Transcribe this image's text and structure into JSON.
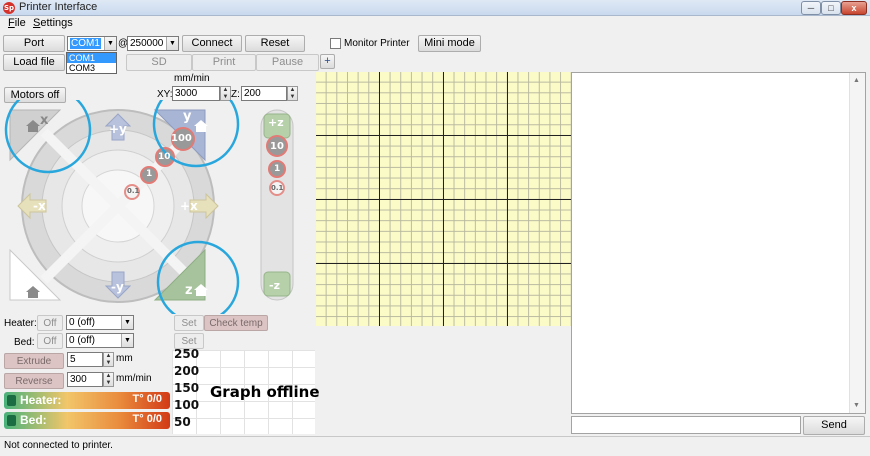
{
  "window": {
    "title": "Printer Interface",
    "icon_text": "Sp"
  },
  "menu": [
    "File",
    "Settings"
  ],
  "toolbar": {
    "port_label": "Port",
    "port_value": "COM1",
    "at_symbol": "@",
    "baud_value": "250000",
    "connect_label": "Connect",
    "reset_label": "Reset",
    "monitor_label": "Monitor Printer",
    "mini_mode_label": "Mini mode",
    "port_options": [
      "COM1",
      "COM3"
    ]
  },
  "toolbar2": {
    "load_file_label": "Load file",
    "sd_label": "SD",
    "print_label": "Print",
    "pause_label": "Pause",
    "plus_label": "+"
  },
  "jog": {
    "motors_off_label": "Motors off",
    "feed_unit": "mm/min",
    "xy_label": "XY:",
    "xy_value": "3000",
    "z_label": "Z:",
    "z_value": "200",
    "home_x_label": "x",
    "home_y_label": "y",
    "home_z_label": "z",
    "plus_y": "+y",
    "minus_y": "-y",
    "plus_x": "+x",
    "minus_x": "-x",
    "plus_z": "+z",
    "minus_z": "-z",
    "step_100": "100",
    "step_10": "10",
    "step_1": "1",
    "step_01": "0.1"
  },
  "temps": {
    "heater_label": "Heater:",
    "heater_off": "Off",
    "heater_value": "0 (off)",
    "bed_label": "Bed:",
    "bed_off": "Off",
    "bed_value": "0 (off)",
    "set_label": "Set",
    "check_temp_label": "Check temp"
  },
  "extrude": {
    "extrude_label": "Extrude",
    "extrude_value": "5",
    "extrude_unit": "mm",
    "reverse_label": "Reverse",
    "reverse_value": "300",
    "reverse_unit": "mm/min"
  },
  "temp_bars": {
    "heater_name": "Heater:",
    "heater_reading": "T° 0/0",
    "bed_name": "Bed:",
    "bed_reading": "T° 0/0"
  },
  "graph": {
    "ticks": [
      "250",
      "200",
      "150",
      "100",
      "50"
    ],
    "status": "Graph offline"
  },
  "console": {
    "send_label": "Send"
  },
  "status_bar": "Not connected to printer.",
  "colors": {
    "accent_circle": "#29a7dd",
    "bed_grid": "#fbfbc8",
    "home_arrow": "#d7d7d7",
    "y_arrow": "#a5b4d8",
    "x_arrow": "#e8e3c0",
    "z_arrow": "#a8c8a0",
    "step_circle": "#e27a75"
  }
}
